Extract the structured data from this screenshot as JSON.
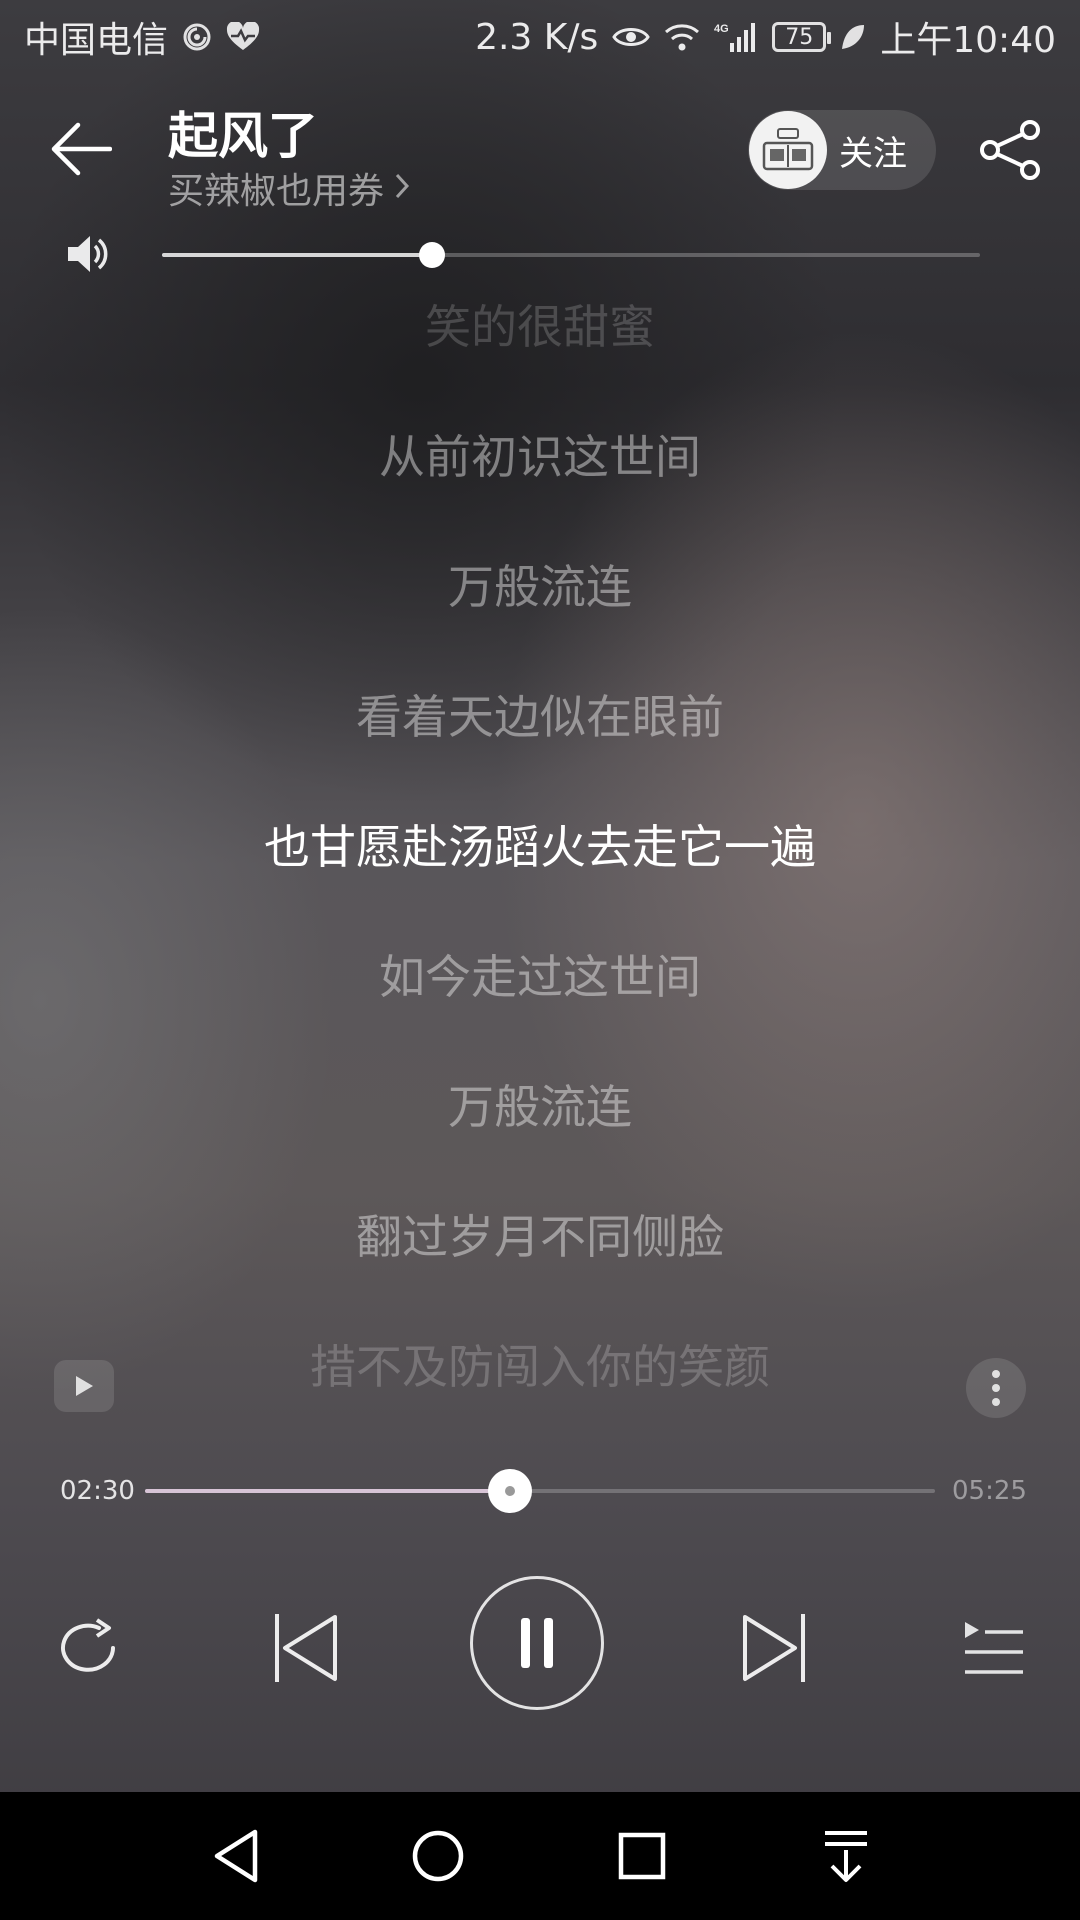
{
  "status_bar": {
    "carrier": "中国电信",
    "net_speed": "2.3 K/s",
    "network_type": "4G",
    "battery": "75",
    "time": "上午10:40"
  },
  "header": {
    "title": "起风了",
    "artist": "买辣椒也用券",
    "artist_chevron": "›",
    "follow_label": "关注"
  },
  "volume": {
    "level": 0.33
  },
  "lyrics": [
    "笑的很甜蜜",
    "从前初识这世间",
    "万般流连",
    "看着天边似在眼前",
    "也甘愿赴汤蹈火去走它一遍",
    "如今走过这世间",
    "万般流连",
    "翻过岁月不同侧脸",
    "措不及防闯入你的笑颜"
  ],
  "current_lyric_index": 4,
  "player": {
    "current_time": "02:30",
    "total_time": "05:25",
    "progress": 0.462,
    "state": "playing"
  },
  "icons": {
    "back": "arrow-left-icon",
    "share": "share-icon",
    "volume": "speaker-icon",
    "mv": "video-play-icon",
    "more": "more-vertical-icon",
    "repeat": "repeat-icon",
    "prev": "skip-previous-icon",
    "pause": "pause-icon",
    "next": "skip-next-icon",
    "playlist": "playlist-icon"
  },
  "colors": {
    "progress_fill": "#d7c4d6",
    "current_lyric": "#ffffff"
  }
}
